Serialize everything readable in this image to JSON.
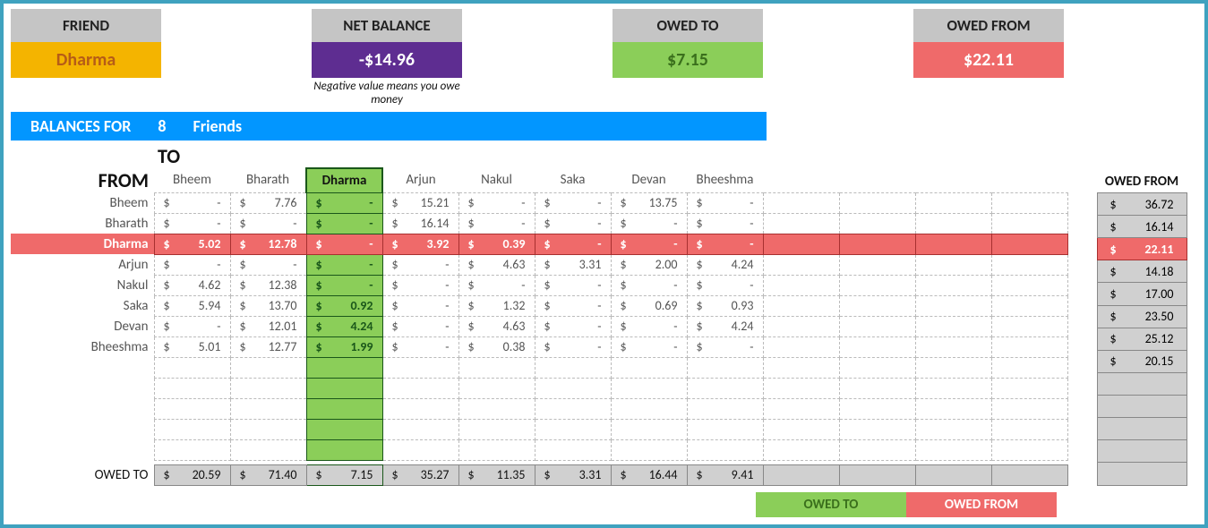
{
  "cards": {
    "friend": {
      "hdr": "FRIEND",
      "val": "Dharma"
    },
    "net": {
      "hdr": "NET BALANCE",
      "val": "-$14.96",
      "note": "Negative value means you owe money"
    },
    "owedto": {
      "hdr": "OWED TO",
      "val": "$7.15"
    },
    "owedfrom": {
      "hdr": "OWED FROM",
      "val": "$22.11"
    }
  },
  "balances_bar": {
    "label": "BALANCES FOR",
    "count": "8",
    "unit": "Friends"
  },
  "labels": {
    "to": "TO",
    "from": "FROM",
    "owed_to": "OWED TO",
    "owed_from": "OWED FROM"
  },
  "friends": [
    "Bheem",
    "Bharath",
    "Dharma",
    "Arjun",
    "Nakul",
    "Saka",
    "Devan",
    "Bheeshma"
  ],
  "grid": [
    [
      "-",
      "7.76",
      "-",
      "15.21",
      "-",
      "-",
      "13.75",
      "-"
    ],
    [
      "-",
      "-",
      "-",
      "16.14",
      "-",
      "-",
      "-",
      "-"
    ],
    [
      "5.02",
      "12.78",
      "-",
      "3.92",
      "0.39",
      "-",
      "-",
      "-"
    ],
    [
      "-",
      "-",
      "-",
      "-",
      "4.63",
      "3.31",
      "2.00",
      "4.24"
    ],
    [
      "4.62",
      "12.38",
      "-",
      "-",
      "-",
      "-",
      "-",
      "-"
    ],
    [
      "5.94",
      "13.70",
      "0.92",
      "-",
      "1.32",
      "-",
      "0.69",
      "0.93"
    ],
    [
      "-",
      "12.01",
      "4.24",
      "-",
      "4.63",
      "-",
      "-",
      "4.24"
    ],
    [
      "5.01",
      "12.77",
      "1.99",
      "-",
      "0.38",
      "-",
      "-",
      "-"
    ]
  ],
  "owed_to_row": [
    "20.59",
    "71.40",
    "7.15",
    "35.27",
    "11.35",
    "3.31",
    "16.44",
    "9.41"
  ],
  "owed_from_col": [
    "36.72",
    "16.14",
    "22.11",
    "14.18",
    "17.00",
    "23.50",
    "25.12",
    "20.15"
  ],
  "highlight_col": 2,
  "highlight_row": 2,
  "extra_cols": 4,
  "extra_rows": 5,
  "side_extra_rows": 5
}
